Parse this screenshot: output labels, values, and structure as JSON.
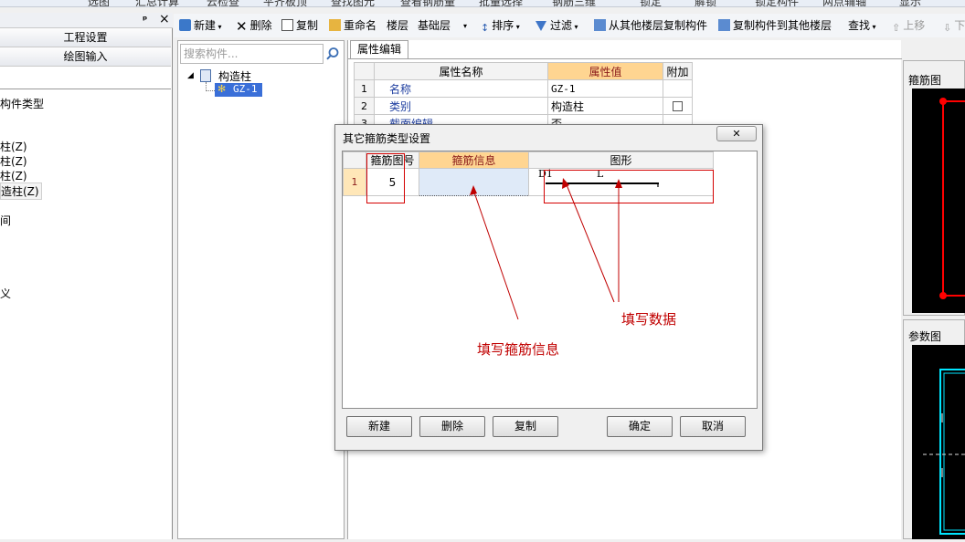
{
  "topbar": {
    "items": [
      "选图",
      "汇总计算",
      "云检查",
      "平齐板顶",
      "查找图元",
      "查看钢筋量",
      "批量选择",
      "钢筋三维",
      "锁定",
      "解锁",
      "锁定构件",
      "两点辅轴",
      "显示"
    ]
  },
  "toolbar": {
    "new": "新建",
    "delete": "删除",
    "copy": "复制",
    "rename": "重命名",
    "floor_label": "楼层",
    "floor_value": "基础层",
    "sort": "排序",
    "filter": "过滤",
    "copy_from": "从其他楼层复制构件",
    "copy_to": "复制构件到其他楼层",
    "find": "查找",
    "move_up": "上移",
    "move_down": "下"
  },
  "left_panel": {
    "pin": "ᵖ",
    "close": "×",
    "nav": [
      "工程设置",
      "绘图输入"
    ],
    "tree": [
      "构件类型",
      "柱(Z)",
      "柱(Z)",
      "柱(Z)",
      "造柱(Z)",
      "间",
      "义"
    ]
  },
  "component_list": {
    "search_placeholder": "搜索构件...",
    "root_label": "构造柱",
    "child_label": "GZ-1"
  },
  "property_editor": {
    "tab": "属性编辑",
    "headers": [
      "属性名称",
      "属性值",
      "附加"
    ],
    "rows": [
      {
        "no": "1",
        "name": "名称",
        "value": "GZ-1"
      },
      {
        "no": "2",
        "name": "类别",
        "value": "构造柱"
      },
      {
        "no": "3",
        "name": "截面编辑",
        "value": "否"
      }
    ]
  },
  "right_panel": {
    "stirrup_title": "箍筋图",
    "param_title": "参数图"
  },
  "dialog": {
    "title": "其它箍筋类型设置",
    "close": "✕",
    "headers": [
      "箍筋图号",
      "箍筋信息",
      "图形"
    ],
    "row": {
      "no": "1",
      "shape_no": "5",
      "info": "",
      "label_d1": "D1",
      "label_l": "L"
    },
    "buttons": {
      "new": "新建",
      "delete": "删除",
      "copy": "复制",
      "ok": "确定",
      "cancel": "取消"
    }
  },
  "annotations": {
    "fill_info": "填写箍筋信息",
    "fill_data": "填写数据"
  },
  "colors": {
    "header_highlight": "#ffd591",
    "selection": "#3a6fd8",
    "annotation_red": "#c00000",
    "rebar_red": "#ff0000",
    "rebar_cyan": "#00e5ff"
  }
}
